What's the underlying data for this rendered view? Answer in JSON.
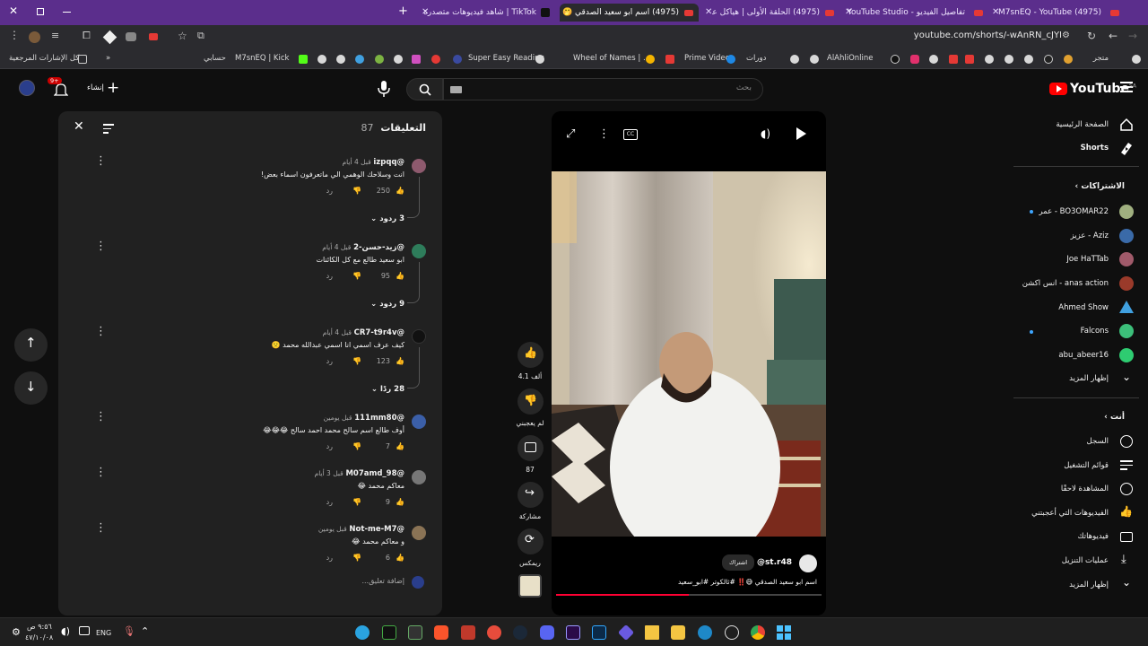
{
  "browser": {
    "tabs": [
      {
        "label": "(4975) M7snEQ - YouTube",
        "active": false
      },
      {
        "label": "تفاصيل الفيديو - YouTube Studio",
        "active": false
      },
      {
        "label": "(4975) الحلقة الأولى | هياكل عملا...",
        "active": false
      },
      {
        "label": "(4975) اسم ابو سعيد الصدقي 🤭",
        "active": true
      },
      {
        "label": "TikTok | شاهد فيديوهات متصدرة",
        "active": false
      }
    ],
    "url": "youtube.com/shorts/-wAnRN_cJYI",
    "bookmarks": [
      "متجر",
      "دورات",
      "AlAhliOnline",
      "Prime Video",
      "Wheel of Names | ...",
      "Super Easy Reading",
      "M7snEQ | Kick",
      "حسابي",
      "كل الإشارات المرجعية"
    ]
  },
  "header": {
    "logo_text": "YouTube",
    "logo_region": "SA",
    "search_placeholder": "بحث",
    "create_label": "إنشاء",
    "notification_count": "9+"
  },
  "comments_panel": {
    "title": "التعليقات",
    "count": "87",
    "reply_label": "رد",
    "add_comment_placeholder": "إضافة تعليق...",
    "items": [
      {
        "author": "@izpqq",
        "time": "قبل 4 أيام",
        "text": "انت وسلاحك الوهمي الي ماتعرفون اسماء بعض!",
        "likes": "250",
        "replies": "3 ردود",
        "avatar_color": "#8e5a6e"
      },
      {
        "author": "@زيد-حسن-2",
        "time": "قبل 4 أيام",
        "text": "ابو سعيد طالع مع كل الكائنات",
        "likes": "95",
        "replies": "9 ردود",
        "avatar_color": "#2e7d5b"
      },
      {
        "author": "@CR7-t9r4v",
        "time": "قبل 4 أيام",
        "text": "كيف عرف اسمي انا اسمي عبدالله محمد 🙁",
        "likes": "123",
        "replies": "28 ردًا",
        "avatar_color": "#111111"
      },
      {
        "author": "@111mm80",
        "time": "قبل يومين",
        "text": "أوف طالع اسم سالح محمد احمد سالح 😂😂😂",
        "likes": "7",
        "replies": "",
        "avatar_color": "#3b5fa8"
      },
      {
        "author": "@M07amd_98",
        "time": "قبل 3 أيام",
        "text": "معاكم محمد 😂",
        "likes": "9",
        "replies": "",
        "avatar_color": "#777777"
      },
      {
        "author": "@Not-me-M7",
        "time": "قبل يومين",
        "text": "و معاكم محمد 😂",
        "likes": "6",
        "replies": "",
        "avatar_color": "#8a7355"
      }
    ]
  },
  "video": {
    "channel": "@st.r48",
    "subscribe_label": "اشتراك",
    "caption": "اسم ابو سعيد الصدقي 😅‼️ #ثالكوتر #ابو_سعيد",
    "progress": 0.5
  },
  "actions": {
    "likes": "4.1 ألف",
    "dislike_label": "لم يعجبني",
    "comments": "87",
    "share_label": "مشاركة",
    "remix_label": "ريمكس"
  },
  "sidebar": {
    "main": [
      {
        "label": "الصفحة الرئيسية",
        "icon": "home-icon"
      },
      {
        "label": "Shorts",
        "icon": "shorts-icon"
      }
    ],
    "subscriptions_title": "الاشتراكات",
    "subscriptions": [
      {
        "label": "BO3OMAR22 - عمر",
        "color": "#a0b080"
      },
      {
        "label": "Aziz - عزيز",
        "color": "#3a6aa8"
      },
      {
        "label": "Joe HaTTab",
        "color": "#a05a6a"
      },
      {
        "label": "anas action - انس اكشن",
        "color": "#9a3a2a"
      },
      {
        "label": "Ahmed Show",
        "color": "#40a0e0"
      },
      {
        "label": "Falcons",
        "color": "#3cbf7a"
      },
      {
        "label": "abu_abeer16",
        "color": "#2ecc71"
      }
    ],
    "show_more": "إظهار المزيد",
    "you_title": "أنت",
    "you_items": [
      {
        "label": "السجل",
        "icon": "history-icon"
      },
      {
        "label": "قوائم التشغيل",
        "icon": "playlist-icon"
      },
      {
        "label": "المشاهدة لاحقًا",
        "icon": "clock-icon"
      },
      {
        "label": "الفيديوهات التي أعجبتني",
        "icon": "like-icon"
      },
      {
        "label": "فيديوهاتك",
        "icon": "video-icon"
      },
      {
        "label": "عمليات التنزيل",
        "icon": "download-icon"
      },
      {
        "label": "إظهار المزيد",
        "icon": "chevron-down-icon"
      }
    ]
  },
  "taskbar": {
    "time": "٩:٥٦ ص",
    "date": "٤٧/١٠/٠٨",
    "language": "ENG"
  }
}
